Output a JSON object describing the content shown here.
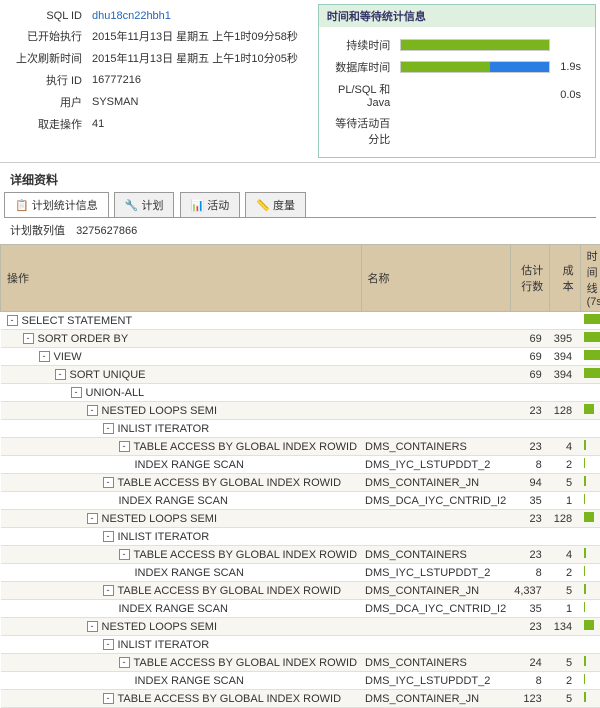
{
  "info": {
    "sql_id_label": "SQL ID",
    "sql_id_value": "dhu18cn22hbh1",
    "start_label": "已开始执行",
    "start_value": "2015年11月13日 星期五 上午1时09分58秒",
    "refresh_label": "上次刷新时间",
    "refresh_value": "2015年11月13日 星期五 上午1时10分05秒",
    "exec_id_label": "执行 ID",
    "exec_id_value": "16777216",
    "user_label": "用户",
    "user_value": "SYSMAN",
    "fetch_label": "取走操作",
    "fetch_value": "41"
  },
  "stats": {
    "title": "时间和等待统计信息",
    "duration_label": "持续时间",
    "db_time_label": "数据库时间",
    "db_time_value": "1.9s",
    "plsql_label": "PL/SQL 和 Java",
    "plsql_value": "0.0s",
    "activity_label": "等待活动百分比"
  },
  "detail_title": "详细资料",
  "tabs": [
    {
      "icon": "📋",
      "label": "计划统计信息"
    },
    {
      "icon": "🔧",
      "label": "计划"
    },
    {
      "icon": "📊",
      "label": "活动"
    },
    {
      "icon": "📏",
      "label": "度量"
    }
  ],
  "plan_hash_label": "计划散列值",
  "plan_hash_value": "3275627866",
  "columns": {
    "operation": "操作",
    "name": "名称",
    "est_rows": "估计行数",
    "cost": "成本",
    "timeline": "时间线(7s)"
  },
  "plan_rows": [
    {
      "depth": 0,
      "toggle": "-",
      "op": "SELECT STATEMENT",
      "name": "",
      "est": "",
      "cost": "",
      "bar": 100
    },
    {
      "depth": 1,
      "toggle": "-",
      "op": "SORT ORDER BY",
      "name": "",
      "est": "69",
      "cost": "395",
      "bar": 95
    },
    {
      "depth": 2,
      "toggle": "-",
      "op": "VIEW",
      "name": "",
      "est": "69",
      "cost": "394",
      "bar": 95
    },
    {
      "depth": 3,
      "toggle": "-",
      "op": "SORT UNIQUE",
      "name": "",
      "est": "69",
      "cost": "394",
      "bar": 95
    },
    {
      "depth": 4,
      "toggle": "-",
      "op": "UNION-ALL",
      "name": "",
      "est": "",
      "cost": "",
      "bar": 0
    },
    {
      "depth": 5,
      "toggle": "-",
      "op": "NESTED LOOPS SEMI",
      "name": "",
      "est": "23",
      "cost": "128",
      "bar": 40
    },
    {
      "depth": 6,
      "toggle": "-",
      "op": "INLIST ITERATOR",
      "name": "",
      "est": "",
      "cost": "",
      "bar": 0
    },
    {
      "depth": 7,
      "toggle": "-",
      "op": "TABLE ACCESS BY GLOBAL INDEX ROWID",
      "name": "DMS_CONTAINERS",
      "est": "23",
      "cost": "4",
      "bar": 6
    },
    {
      "depth": 8,
      "toggle": "",
      "op": "INDEX RANGE SCAN",
      "name": "DMS_IYC_LSTUPDDT_2",
      "est": "8",
      "cost": "2",
      "bar": 4
    },
    {
      "depth": 6,
      "toggle": "-",
      "op": "TABLE ACCESS BY GLOBAL INDEX ROWID",
      "name": "DMS_CONTAINER_JN",
      "est": "94",
      "cost": "5",
      "bar": 8
    },
    {
      "depth": 7,
      "toggle": "",
      "op": "INDEX RANGE SCAN",
      "name": "DMS_DCA_IYC_CNTRID_I2",
      "est": "35",
      "cost": "1",
      "bar": 3
    },
    {
      "depth": 5,
      "toggle": "-",
      "op": "NESTED LOOPS SEMI",
      "name": "",
      "est": "23",
      "cost": "128",
      "bar": 40
    },
    {
      "depth": 6,
      "toggle": "-",
      "op": "INLIST ITERATOR",
      "name": "",
      "est": "",
      "cost": "",
      "bar": 0
    },
    {
      "depth": 7,
      "toggle": "-",
      "op": "TABLE ACCESS BY GLOBAL INDEX ROWID",
      "name": "DMS_CONTAINERS",
      "est": "23",
      "cost": "4",
      "bar": 6
    },
    {
      "depth": 8,
      "toggle": "",
      "op": "INDEX RANGE SCAN",
      "name": "DMS_IYC_LSTUPDDT_2",
      "est": "8",
      "cost": "2",
      "bar": 4
    },
    {
      "depth": 6,
      "toggle": "-",
      "op": "TABLE ACCESS BY GLOBAL INDEX ROWID",
      "name": "DMS_CONTAINER_JN",
      "est": "4,337",
      "cost": "5",
      "bar": 8
    },
    {
      "depth": 7,
      "toggle": "",
      "op": "INDEX RANGE SCAN",
      "name": "DMS_DCA_IYC_CNTRID_I2",
      "est": "35",
      "cost": "1",
      "bar": 3
    },
    {
      "depth": 5,
      "toggle": "-",
      "op": "NESTED LOOPS SEMI",
      "name": "",
      "est": "23",
      "cost": "134",
      "bar": 42
    },
    {
      "depth": 6,
      "toggle": "-",
      "op": "INLIST ITERATOR",
      "name": "",
      "est": "",
      "cost": "",
      "bar": 0
    },
    {
      "depth": 7,
      "toggle": "-",
      "op": "TABLE ACCESS BY GLOBAL INDEX ROWID",
      "name": "DMS_CONTAINERS",
      "est": "24",
      "cost": "5",
      "bar": 8
    },
    {
      "depth": 8,
      "toggle": "",
      "op": "INDEX RANGE SCAN",
      "name": "DMS_IYC_LSTUPDDT_2",
      "est": "8",
      "cost": "2",
      "bar": 4
    },
    {
      "depth": 6,
      "toggle": "-",
      "op": "TABLE ACCESS BY GLOBAL INDEX ROWID",
      "name": "DMS_CONTAINER_JN",
      "est": "123",
      "cost": "5",
      "bar": 8
    }
  ]
}
